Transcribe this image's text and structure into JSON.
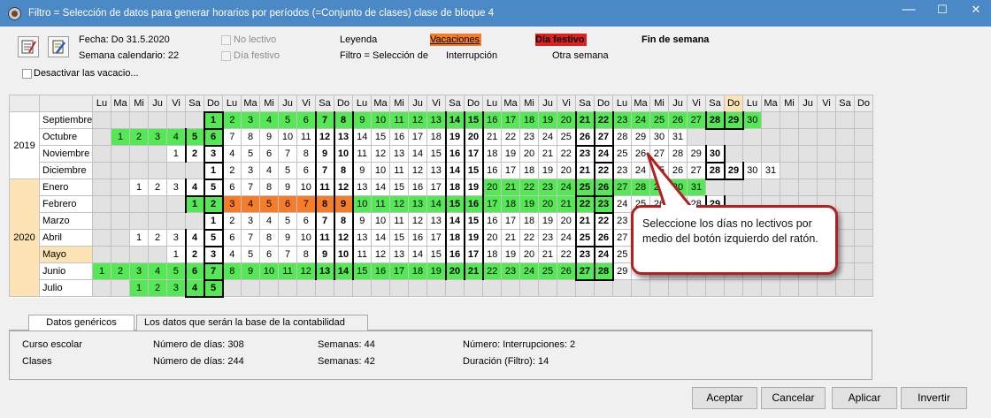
{
  "window": {
    "title": "Filtro = Selección de datos para generar horarios por períodos (=Conjunto de clases) clase de bloque 4",
    "min_glyph": "—",
    "max_glyph": "☐",
    "close_glyph": "✕"
  },
  "header": {
    "fecha": "Fecha: Do 31.5.2020",
    "semana": "Semana calendario: 22",
    "desactivar": "Desactivar las vacacio...",
    "no_lectivo": "No lectivo",
    "dia_festivo": "Día festivo",
    "leyenda": "Leyenda",
    "filtro": "Filtro = Selección de",
    "vacaciones": "Vacaciones",
    "festivo": "Día festivo",
    "fin_semana": "Fin de semana",
    "interrupcion": "Interrupción",
    "otra_semana": "Otra semana"
  },
  "calendar": {
    "weekday_headers": [
      "Lu",
      "Ma",
      "Mi",
      "Ju",
      "Vi",
      "Sa",
      "Do",
      "Lu",
      "Ma",
      "Mi",
      "Ju",
      "Vi",
      "Sa",
      "Do",
      "Lu",
      "Ma",
      "Mi",
      "Ju",
      "Vi",
      "Sa",
      "Do",
      "Lu",
      "Ma",
      "Mi",
      "Ju",
      "Vi",
      "Sa",
      "Do",
      "Lu",
      "Ma",
      "Mi",
      "Ju",
      "Vi",
      "Sa",
      "Do",
      "Lu",
      "Ma",
      "Mi",
      "Ju",
      "Vi",
      "Sa",
      "Do"
    ],
    "highlight_header_index": 34,
    "years": [
      "2019",
      "2020"
    ],
    "months": [
      {
        "name": "Septiembre",
        "year": "2019",
        "offset": 6,
        "days": 30,
        "green": [
          [
            1,
            30
          ]
        ],
        "orange": []
      },
      {
        "name": "Octubre",
        "year": "2019",
        "offset": 1,
        "days": 31,
        "green": [
          [
            1,
            6
          ]
        ],
        "orange": []
      },
      {
        "name": "Noviembre",
        "year": "2019",
        "offset": 4,
        "days": 30,
        "green": [],
        "orange": []
      },
      {
        "name": "Diciembre",
        "year": "2019",
        "offset": 6,
        "days": 31,
        "green": [],
        "orange": []
      },
      {
        "name": "Enero",
        "year": "2020",
        "offset": 2,
        "days": 31,
        "green": [
          [
            20,
            31
          ]
        ],
        "orange": []
      },
      {
        "name": "Febrero",
        "year": "2020",
        "offset": 5,
        "days": 29,
        "green": [
          [
            1,
            2
          ],
          [
            10,
            23
          ]
        ],
        "orange": [
          [
            3,
            9
          ]
        ]
      },
      {
        "name": "Marzo",
        "year": "2020",
        "offset": 6,
        "days": 31,
        "green": [],
        "orange": []
      },
      {
        "name": "Abril",
        "year": "2020",
        "offset": 2,
        "days": 30,
        "green": [],
        "orange": []
      },
      {
        "name": "Mayo",
        "year": "2020",
        "offset": 4,
        "days": 31,
        "green": [],
        "orange": [],
        "selected": true
      },
      {
        "name": "Junio",
        "year": "2020",
        "offset": 0,
        "days": 30,
        "green": [
          [
            1,
            28
          ]
        ],
        "orange": []
      },
      {
        "name": "Julio",
        "year": "2020",
        "offset": 2,
        "days": 5,
        "green": [
          [
            1,
            5
          ]
        ],
        "orange": []
      }
    ]
  },
  "callout": {
    "text": "Seleccione los días no lectivos por medio del botón izquierdo del ratón."
  },
  "tabs": [
    {
      "label": "Datos genéricos",
      "active": true
    },
    {
      "label": "Los datos que serán la base de la contabilidad",
      "active": false
    }
  ],
  "stats": {
    "curso_label": "Curso escolar",
    "curso_dias": "Número de días: 308",
    "curso_semanas": "Semanas: 44",
    "curso_interrupciones": "Número: Interrupciones: 2",
    "clases_label": "Clases",
    "clases_dias": "Número de días: 244",
    "clases_semanas": "Semanas: 42",
    "clases_duracion": "Duración (Filtro): 14"
  },
  "buttons": {
    "aceptar": "Aceptar",
    "cancelar": "Cancelar",
    "aplicar": "Aplicar",
    "invertir": "Invertir"
  },
  "colors": {
    "titlebar": "#4a88c6",
    "green": "#55e855",
    "orange": "#f57d29",
    "red": "#e02020",
    "highlight": "#fde3b4",
    "callout_border": "#b42020"
  }
}
